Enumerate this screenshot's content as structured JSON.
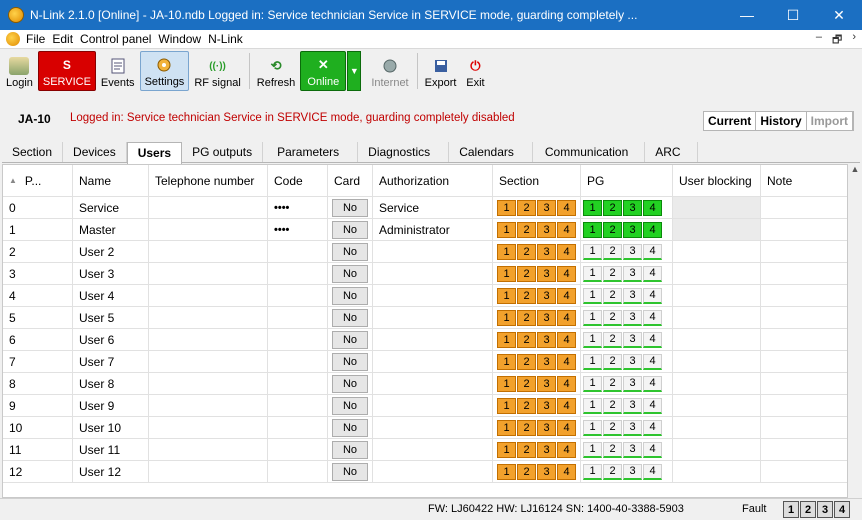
{
  "window": {
    "title": "N-Link 2.1.0 [Online] - JA-10.ndb Logged in: Service technician Service in SERVICE mode, guarding completely ...",
    "minimize": "—",
    "maximize": "☐",
    "close": "✕"
  },
  "menu": {
    "items": [
      "File",
      "Edit",
      "Control panel",
      "Window",
      "N-Link"
    ],
    "mdi_min": "–",
    "mdi_restore": "🗗",
    "mdi_close": "›"
  },
  "toolbar": {
    "login": "Login",
    "service_letter": "S",
    "service": "SERVICE",
    "events": "Events",
    "settings": "Settings",
    "rf_signal": "RF signal",
    "refresh": "Refresh",
    "online": "Online",
    "internet": "Internet",
    "export": "Export",
    "exit": "Exit"
  },
  "status": {
    "device": "JA-10",
    "logged_in": "Logged in: Service technician Service in SERVICE mode, guarding completely disabled"
  },
  "view_tabs": [
    "Current",
    "History",
    "Import"
  ],
  "tabs": [
    "Section",
    "Devices",
    "Users",
    "PG outputs",
    "Parameters",
    "Diagnostics",
    "Calendars",
    "Communication",
    "ARC"
  ],
  "active_tab": "Users",
  "table": {
    "headers": {
      "pos": "P...",
      "name": "Name",
      "tel": "Telephone number",
      "code": "Code",
      "card": "Card",
      "auth": "Authorization",
      "section": "Section",
      "pg": "PG",
      "blocking": "User blocking",
      "note": "Note"
    },
    "numbers": [
      "1",
      "2",
      "3",
      "4"
    ],
    "rows": [
      {
        "pos": "0",
        "name": "Service",
        "code": "••••",
        "card": "No",
        "auth": "Service",
        "pg_active": true
      },
      {
        "pos": "1",
        "name": "Master",
        "code": "••••",
        "card": "No",
        "auth": "Administrator",
        "pg_active": true
      },
      {
        "pos": "2",
        "name": "User 2",
        "code": "",
        "card": "No",
        "auth": "",
        "pg_active": false
      },
      {
        "pos": "3",
        "name": "User 3",
        "code": "",
        "card": "No",
        "auth": "",
        "pg_active": false
      },
      {
        "pos": "4",
        "name": "User 4",
        "code": "",
        "card": "No",
        "auth": "",
        "pg_active": false
      },
      {
        "pos": "5",
        "name": "User 5",
        "code": "",
        "card": "No",
        "auth": "",
        "pg_active": false
      },
      {
        "pos": "6",
        "name": "User 6",
        "code": "",
        "card": "No",
        "auth": "",
        "pg_active": false
      },
      {
        "pos": "7",
        "name": "User 7",
        "code": "",
        "card": "No",
        "auth": "",
        "pg_active": false
      },
      {
        "pos": "8",
        "name": "User 8",
        "code": "",
        "card": "No",
        "auth": "",
        "pg_active": false
      },
      {
        "pos": "9",
        "name": "User 9",
        "code": "",
        "card": "No",
        "auth": "",
        "pg_active": false
      },
      {
        "pos": "10",
        "name": "User 10",
        "code": "",
        "card": "No",
        "auth": "",
        "pg_active": false
      },
      {
        "pos": "11",
        "name": "User 11",
        "code": "",
        "card": "No",
        "auth": "",
        "pg_active": false
      },
      {
        "pos": "12",
        "name": "User 12",
        "code": "",
        "card": "No",
        "auth": "",
        "pg_active": false
      }
    ]
  },
  "bottom": {
    "fw": "FW: LJ60422 HW: LJ16124 SN: 1400-40-3388-5903",
    "fault": "Fault",
    "fault_boxes": [
      "1",
      "2",
      "3",
      "4"
    ]
  },
  "colors": {
    "titlebar": "#1b6fc2",
    "section_orange": "#f2a12c",
    "pg_green": "#22d122",
    "service_red": "#d80000",
    "logged_in_text": "#c00000"
  }
}
